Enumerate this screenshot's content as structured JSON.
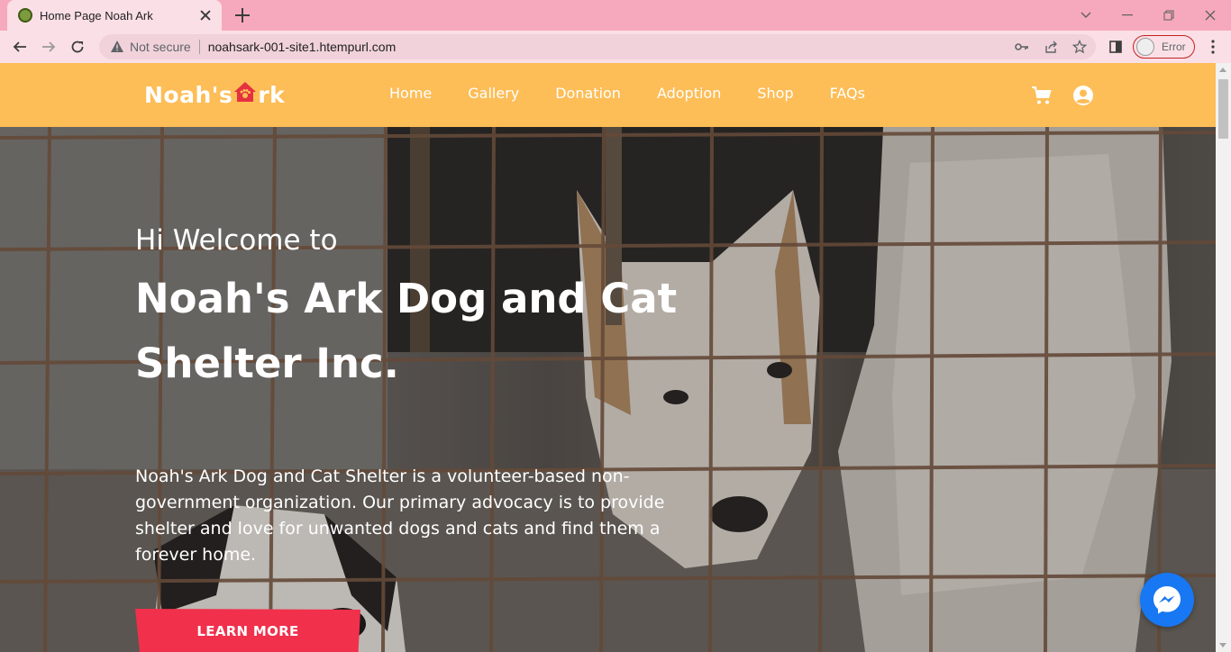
{
  "browser": {
    "tab_title": "Home Page Noah Ark",
    "security_label": "Not secure",
    "url": "noahsark-001-site1.htempurl.com",
    "profile_label": "Error"
  },
  "site": {
    "logo_left": "Noah's",
    "logo_right": "rk",
    "nav": [
      "Home",
      "Gallery",
      "Donation",
      "Adoption",
      "Shop",
      "FAQs"
    ]
  },
  "hero": {
    "greeting": "Hi Welcome to",
    "title": "Noah's Ark Dog and Cat Shelter Inc.",
    "description": "Noah's Ark Dog and Cat Shelter is a volunteer-based non-government organization. Our primary advocacy is to provide shelter and love for unwanted dogs and cats and find them a forever home.",
    "cta_label": "LEARN MORE"
  },
  "colors": {
    "header_bg": "#fdbd57",
    "cta_bg": "#f1304c",
    "messenger_bg": "#1877f2",
    "tabstrip_bg": "#f6a9bc"
  },
  "icons": [
    "favicon-icon",
    "close-icon",
    "plus-icon",
    "back-icon",
    "forward-icon",
    "reload-icon",
    "warning-icon",
    "key-icon",
    "share-icon",
    "star-icon",
    "sidepanel-icon",
    "more-icon",
    "cart-icon",
    "user-icon",
    "messenger-icon"
  ]
}
